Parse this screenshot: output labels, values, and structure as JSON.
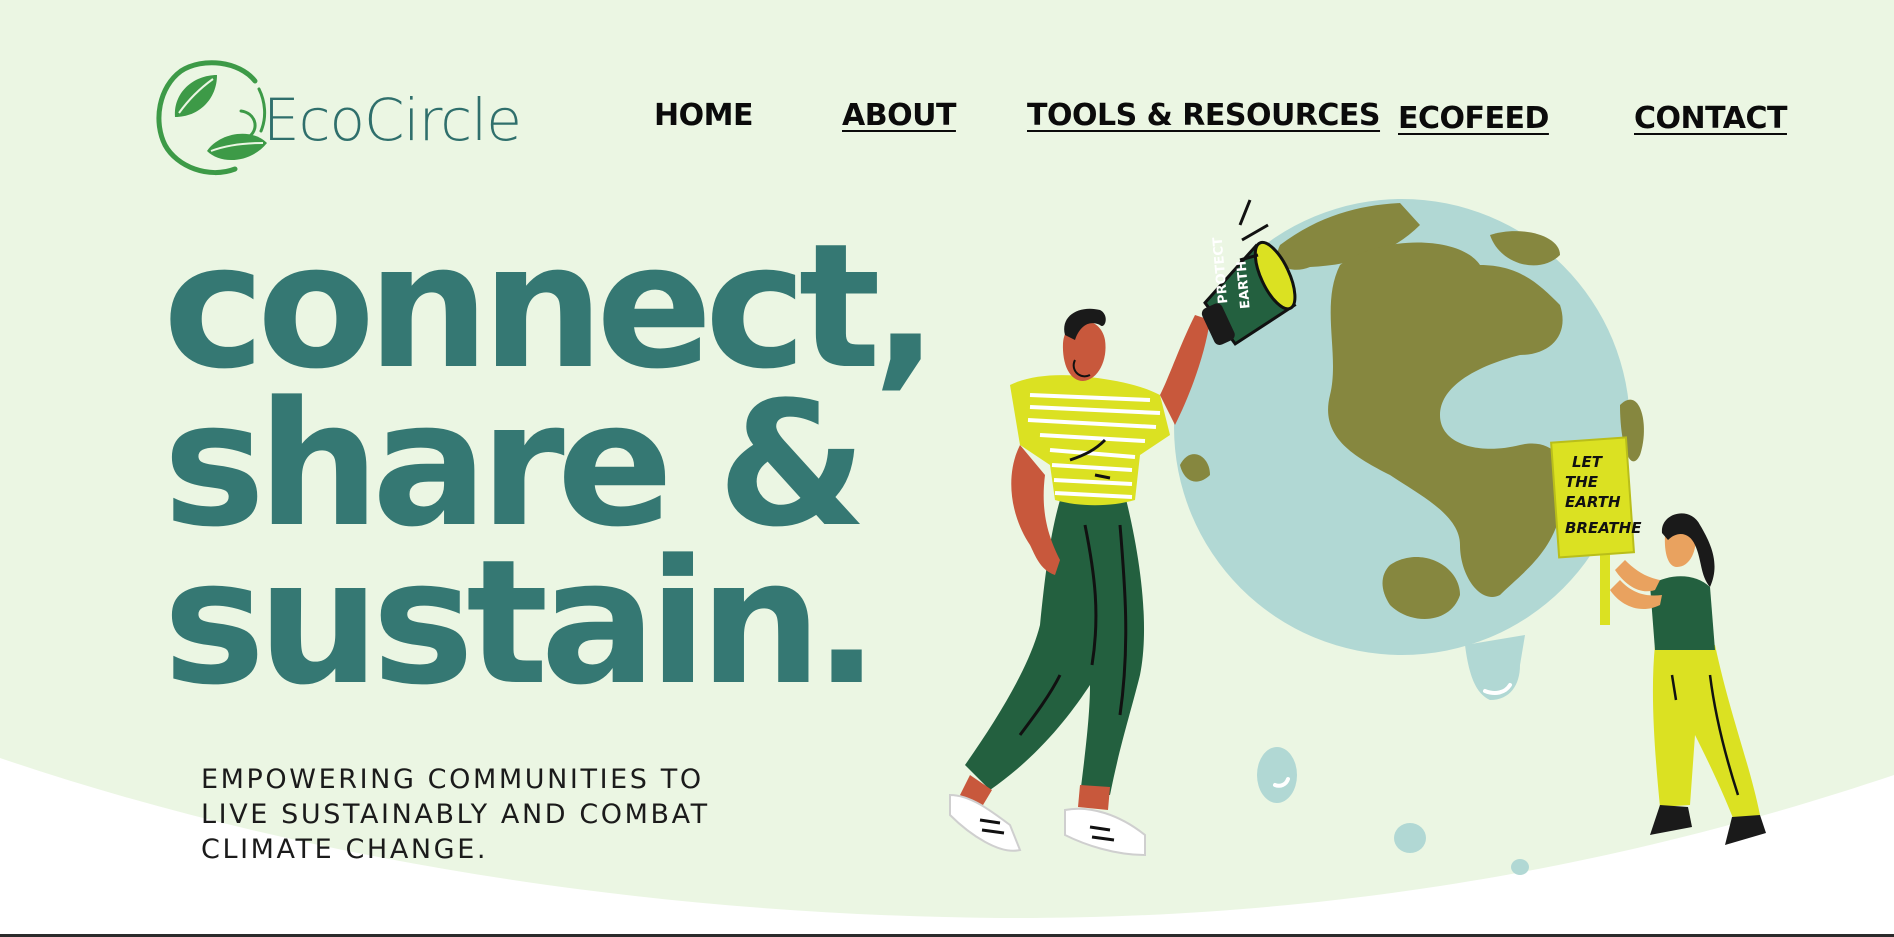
{
  "colors": {
    "background": "#ebf6e3",
    "curve_bottom": "#ffffff",
    "headline": "#357873",
    "logo_text": "#2f6f6c",
    "logo_green": "#3d9a47",
    "nav_text": "#0b0b0b",
    "globe_water": "#b1d8d4",
    "globe_land": "#86873f",
    "shirt_yellow": "#dbe122",
    "pants_green": "#23603f",
    "skin": "#c8583c"
  },
  "brand": {
    "name": "EcoCircle",
    "logo_icon": "leaf-circle-icon"
  },
  "nav": {
    "items": [
      {
        "label": "HOME"
      },
      {
        "label": "ABOUT"
      },
      {
        "label": "TOOLS & RESOURCES"
      },
      {
        "label": "ECOFEED"
      },
      {
        "label": "CONTACT"
      }
    ]
  },
  "hero": {
    "headline_lines": [
      "connect,",
      "share &",
      "sustain."
    ],
    "tagline": "EMPOWERING COMMUNITIES TO LIVE SUSTAINABLY AND COMBAT CLIMATE CHANGE.",
    "illustration": {
      "megaphone_text": [
        "PROTECT",
        "EARTH"
      ],
      "sign_text": [
        "LET",
        "THE",
        "EARTH",
        "BREATHE"
      ]
    }
  }
}
